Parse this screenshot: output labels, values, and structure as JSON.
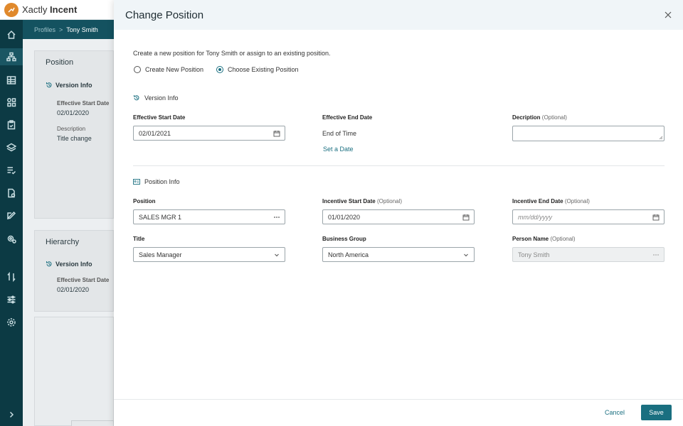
{
  "app": {
    "brand_regular": "Xactly ",
    "brand_bold": "Incent",
    "accent": "#1a6f80",
    "rail_color": "#0c3a44"
  },
  "breadcrumb": {
    "parent": "Profiles",
    "separator": ">",
    "current": "Tony Smith"
  },
  "rail_icons": [
    "home-icon",
    "org-chart-icon",
    "table-icon",
    "apps-icon",
    "clipboard-icon",
    "layers-icon",
    "checklist-icon",
    "document-settings-icon",
    "edit-icon",
    "gear-badge-icon",
    "transfer-icon",
    "sliders-icon",
    "settings-icon",
    "expand-icon"
  ],
  "background": {
    "position_card": {
      "title": "Position",
      "version_info": "Version Info",
      "start_label": "Effective Start Date",
      "start_value": "02/01/2020",
      "description_label": "Description",
      "description_value": "Title change"
    },
    "hierarchy_card": {
      "title": "Hierarchy",
      "version_info": "Version Info",
      "start_label": "Effective Start Date",
      "start_value": "02/01/2020"
    }
  },
  "modal": {
    "title": "Change Position",
    "intro": "Create a new position for Tony Smith or assign to an existing position.",
    "radio_new": "Create New Position",
    "radio_existing": "Choose Existing Position",
    "selected_option": "Choose Existing Position",
    "version_section": "Version Info",
    "effective_start_label": "Effective Start Date",
    "effective_start_value": "02/01/2021",
    "effective_end_label": "Effective End Date",
    "effective_end_value": "End of Time",
    "set_date_link": "Set a Date",
    "description_label": "Decription",
    "optional": "(Optional)",
    "description_value": "",
    "position_section": "Position Info",
    "position_label": "Position",
    "position_value": "SALES MGR 1",
    "incentive_start_label": "Incentive Start Date",
    "incentive_start_value": "01/01/2020",
    "incentive_end_label": "Incentive End Date",
    "incentive_end_placeholder": "mm/dd/yyyy",
    "title_label": "Title",
    "title_value": "Sales Manager",
    "business_group_label": "Business Group",
    "business_group_value": "North America",
    "person_name_label": "Person Name",
    "person_name_value": "Tony Smith",
    "cancel_label": "Cancel",
    "save_label": "Save"
  }
}
